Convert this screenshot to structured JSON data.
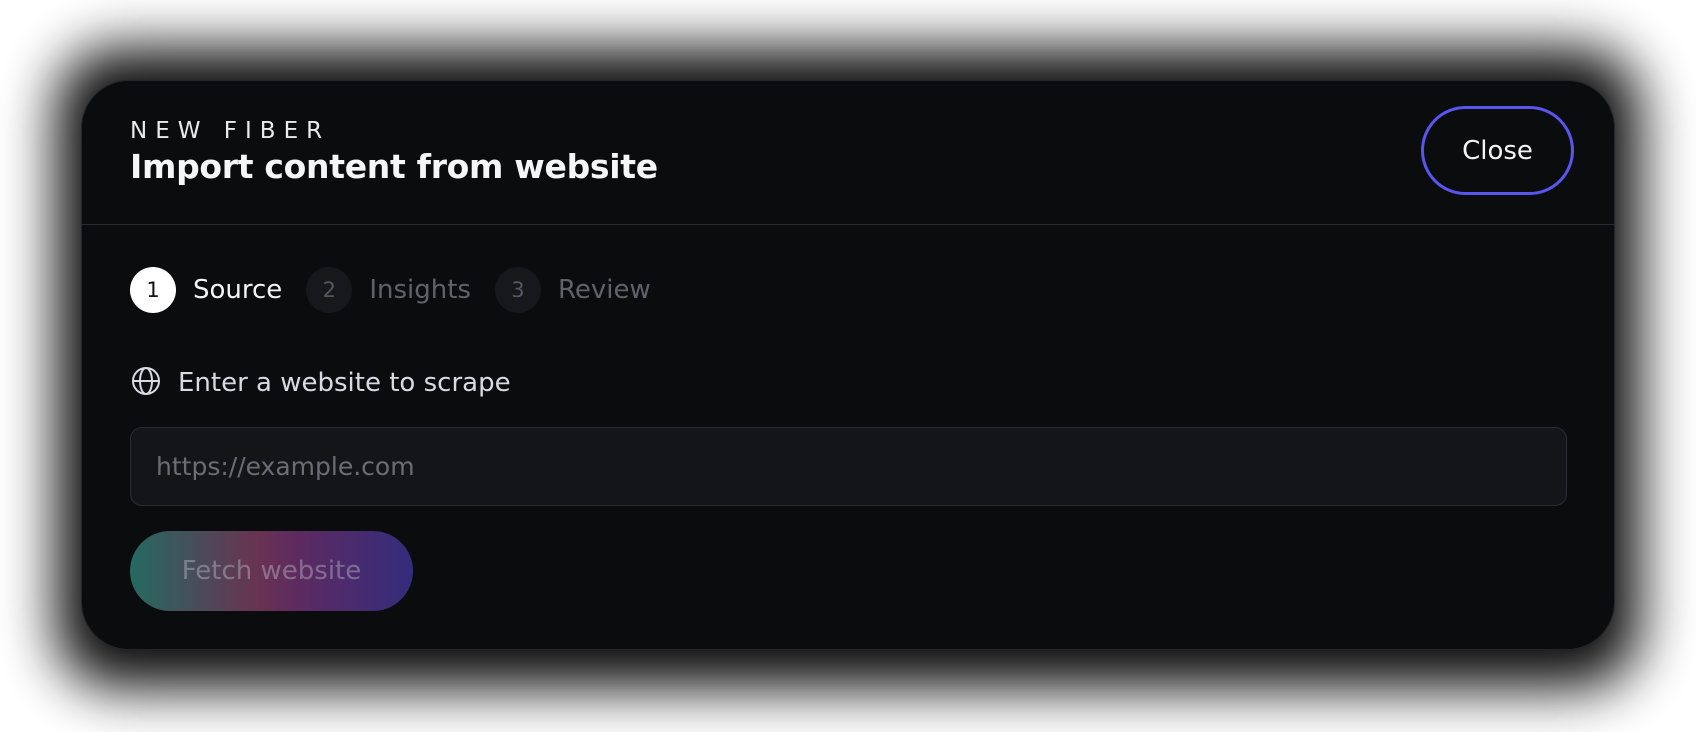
{
  "header": {
    "eyebrow": "NEW FIBER",
    "title": "Import content from website",
    "close_label": "Close"
  },
  "steps": [
    {
      "number": "1",
      "label": "Source",
      "state": "active"
    },
    {
      "number": "2",
      "label": "Insights",
      "state": "inactive"
    },
    {
      "number": "3",
      "label": "Review",
      "state": "inactive"
    }
  ],
  "form": {
    "label": "Enter a website to scrape",
    "icon": "globe-icon",
    "url_value": "",
    "url_placeholder": "https://example.com",
    "submit_label": "Fetch website"
  },
  "colors": {
    "accent": "#5b55f0",
    "background": "#0b0c0e"
  }
}
